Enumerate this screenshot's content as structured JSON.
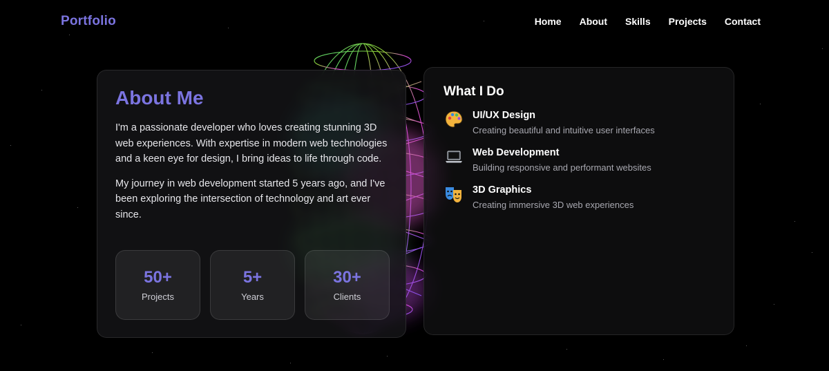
{
  "nav": {
    "brand": "Portfolio",
    "links": [
      "Home",
      "About",
      "Skills",
      "Projects",
      "Contact"
    ]
  },
  "about": {
    "title": "About Me",
    "paragraphs": [
      "I'm a passionate developer who loves creating stunning 3D web experiences. With expertise in modern web technologies and a keen eye for design, I bring ideas to life through code.",
      "My journey in web development started 5 years ago, and I've been exploring the intersection of technology and art ever since."
    ],
    "stats": [
      {
        "value": "50+",
        "label": "Projects"
      },
      {
        "value": "5+",
        "label": "Years"
      },
      {
        "value": "30+",
        "label": "Clients"
      }
    ]
  },
  "what_i_do": {
    "title": "What I Do",
    "services": [
      {
        "icon": "palette-icon",
        "title": "UI/UX Design",
        "desc": "Creating beautiful and intuitive user interfaces"
      },
      {
        "icon": "laptop-icon",
        "title": "Web Development",
        "desc": "Building responsive and performant websites"
      },
      {
        "icon": "theater-masks-icon",
        "title": "3D Graphics",
        "desc": "Creating immersive 3D web experiences"
      }
    ]
  },
  "colors": {
    "accent": "#7b74e0",
    "background": "#000000",
    "card": "#141416"
  }
}
